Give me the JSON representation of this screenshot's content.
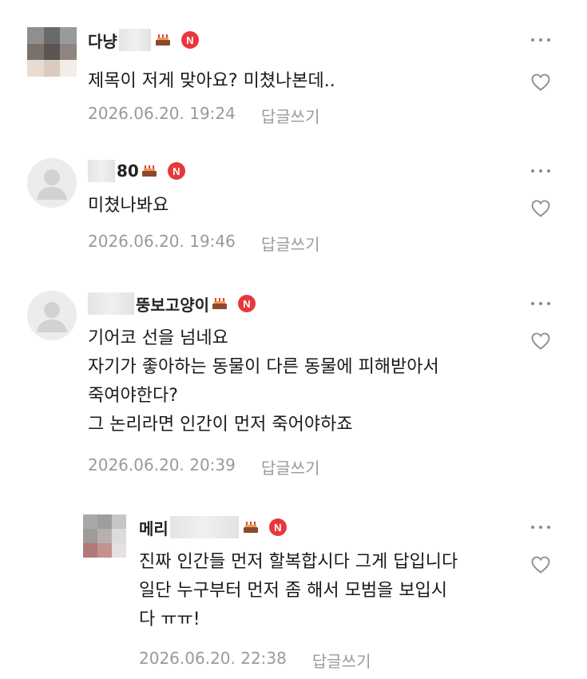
{
  "comments": [
    {
      "username_visible": "다냥",
      "text_lines": [
        "제목이 저게 맞아요? 미쳤나본데.."
      ],
      "timestamp": "2026.06.20. 19:24",
      "reply_label": "답글쓰기",
      "badge_letter": "N"
    },
    {
      "username_visible": "80",
      "text_lines": [
        "미쳤나봐요"
      ],
      "timestamp": "2026.06.20. 19:46",
      "reply_label": "답글쓰기",
      "badge_letter": "N"
    },
    {
      "username_visible": "뚱보고양이",
      "text_lines": [
        "기어코 선을 넘네요",
        "자기가 좋아하는 동물이 다른 동물에 피해받아서",
        "죽여야한다?",
        "그 논리라면 인간이 먼저 죽어야하죠"
      ],
      "timestamp": "2026.06.20. 20:39",
      "reply_label": "답글쓰기",
      "badge_letter": "N"
    },
    {
      "username_visible": "메리",
      "text_lines": [
        "진짜 인간들 먼저 할복합시다 그게 답입니다",
        "일단 누구부터 먼저 좀 해서 모범을 보입시",
        "다 ㅠㅠ!"
      ],
      "timestamp": "2026.06.20. 22:38",
      "reply_label": "답글쓰기",
      "badge_letter": "N"
    }
  ],
  "colors": {
    "badge": "#e8383d",
    "meta_text": "#9a9a9a",
    "body_text": "#1a1a1a"
  },
  "icons": [
    "more-options-icon",
    "heart-icon",
    "cake-icon",
    "naver-n-badge",
    "default-avatar-icon"
  ]
}
